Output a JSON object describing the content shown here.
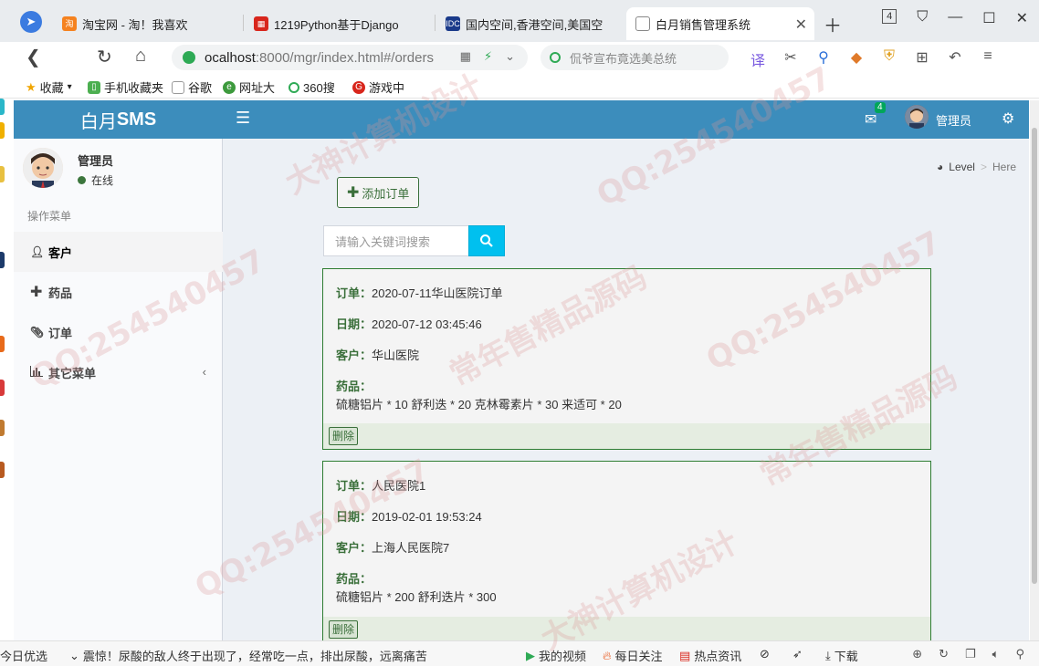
{
  "browser": {
    "tabs": [
      {
        "label": "淘宝网 - 淘！我喜欢",
        "active": false
      },
      {
        "label": "1219Python基于Django",
        "active": false
      },
      {
        "label": "国内空间,香港空间,美国空",
        "active": false
      },
      {
        "label": "白月销售管理系统",
        "active": true
      }
    ],
    "tab_count": "4",
    "url_host": "ocalhost",
    "url_rest": ":8000/mgr/index.html#/orders",
    "search_placeholder": "侃爷宣布竟选美总统",
    "bookmarks": [
      "收藏",
      "手机收藏夹",
      "谷歌",
      "网址大",
      "360搜",
      "游戏中"
    ]
  },
  "app": {
    "brand_light": "白月",
    "brand_bold": "SMS",
    "mail_count": "4",
    "username": "管理员"
  },
  "sidebar": {
    "user_name": "管理员",
    "user_status": "在线",
    "menu_header": "操作菜单",
    "items": [
      {
        "label": "客户",
        "icon": "user-icon"
      },
      {
        "label": "药品",
        "icon": "plus-icon"
      },
      {
        "label": "订单",
        "icon": "paperclip-icon"
      },
      {
        "label": "其它菜单",
        "icon": "bar-chart-icon"
      }
    ]
  },
  "content": {
    "breadcrumb_level": "Level",
    "breadcrumb_here": "Here",
    "add_button": "添加订单",
    "search_placeholder": "请输入关键词搜索",
    "label_order": "订单：",
    "label_date": "日期：",
    "label_customer": "客户：",
    "label_medicine": "药品：",
    "delete_label": "删除",
    "orders": [
      {
        "name": "2020-07-11华山医院订单",
        "date": "2020-07-12 03:45:46",
        "customer": "华山医院",
        "medicines": "硫糖铝片 * 10 舒利迭 * 20 克林霉素片 * 30 来适可 * 20"
      },
      {
        "name": "人民医院1",
        "date": "2019-02-01 19:53:24",
        "customer": "上海人民医院7",
        "medicines": "硫糖铝片 * 200 舒利迭片 * 300"
      }
    ]
  },
  "statusbar": {
    "left": "今日优选",
    "news": "震惊！尿酸的敌人终于出现了，经常吃一点，排出尿酸，远离痛苦",
    "items": [
      "我的视频",
      "每日关注",
      "热点资讯",
      "下载"
    ]
  },
  "watermarks": [
    "QQ:254540457",
    "常年售精品源码",
    "大神计算机设计"
  ],
  "colors": {
    "header": "#3c8dbc",
    "search_button": "#00c0ef",
    "order_border": "#2e7d32",
    "online": "#3c763d"
  }
}
